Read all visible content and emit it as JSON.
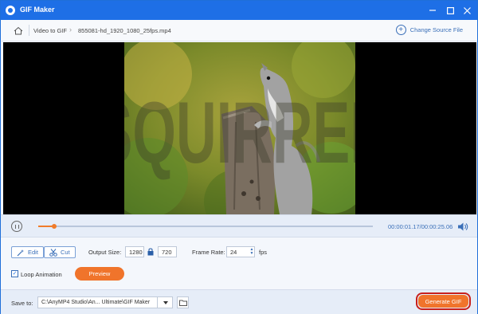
{
  "window": {
    "title": "GIF Maker"
  },
  "breadcrumb": {
    "items": [
      "Video to GIF",
      "855081-hd_1920_1080_25fps.mp4"
    ]
  },
  "nav": {
    "change_source_label": "Change Source File"
  },
  "player": {
    "elapsed": "00:00:01.17",
    "total": "00:00:25.06",
    "time_text": "00:00:01.17/00:00:25.06",
    "progress": 0.047
  },
  "settings": {
    "edit_label": "Edit",
    "cut_label": "Cut",
    "output_size_label": "Output Size:",
    "width": "1280",
    "height": "720",
    "frame_rate_label": "Frame Rate:",
    "frame_rate": "24",
    "fps_unit": "fps",
    "loop_label": "Loop Animation",
    "loop_checked": true,
    "preview_label": "Preview"
  },
  "footer": {
    "save_to_label": "Save to:",
    "save_path": "C:\\AnyMP4 Studio\\An... Ultimate\\GIF Maker",
    "generate_label": "Generate GIF"
  },
  "colors": {
    "titlebar": "#1e6fe6",
    "accent": "#f0742b",
    "highlight": "#c8201c"
  },
  "video_overlay_text": "SQUIRREL"
}
